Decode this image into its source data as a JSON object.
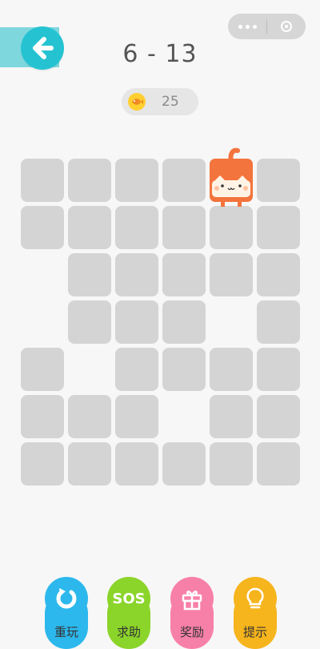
{
  "level_title": "6 - 13",
  "coins": "25",
  "grid": {
    "cols": 6,
    "rows": 7,
    "tiles": [
      [
        1,
        1,
        1,
        1,
        0,
        1
      ],
      [
        1,
        1,
        1,
        1,
        1,
        1
      ],
      [
        0,
        1,
        1,
        1,
        1,
        1
      ],
      [
        0,
        1,
        1,
        1,
        0,
        1
      ],
      [
        1,
        0,
        1,
        1,
        1,
        1
      ],
      [
        1,
        1,
        1,
        0,
        1,
        1
      ],
      [
        1,
        1,
        1,
        1,
        1,
        1
      ]
    ],
    "player_position": {
      "row": 0,
      "col": 4
    }
  },
  "toolbar": {
    "restart_label": "重玩",
    "sos_label": "求助",
    "reward_label": "奖励",
    "hint_label": "提示",
    "sos_icon_text": "SOS"
  },
  "colors": {
    "tile": "#d4d4d4",
    "back_button": "#25c3d2",
    "restart": "#2cb8ec",
    "sos": "#8bd42a",
    "reward": "#f780a8",
    "hint": "#f6b41d"
  }
}
